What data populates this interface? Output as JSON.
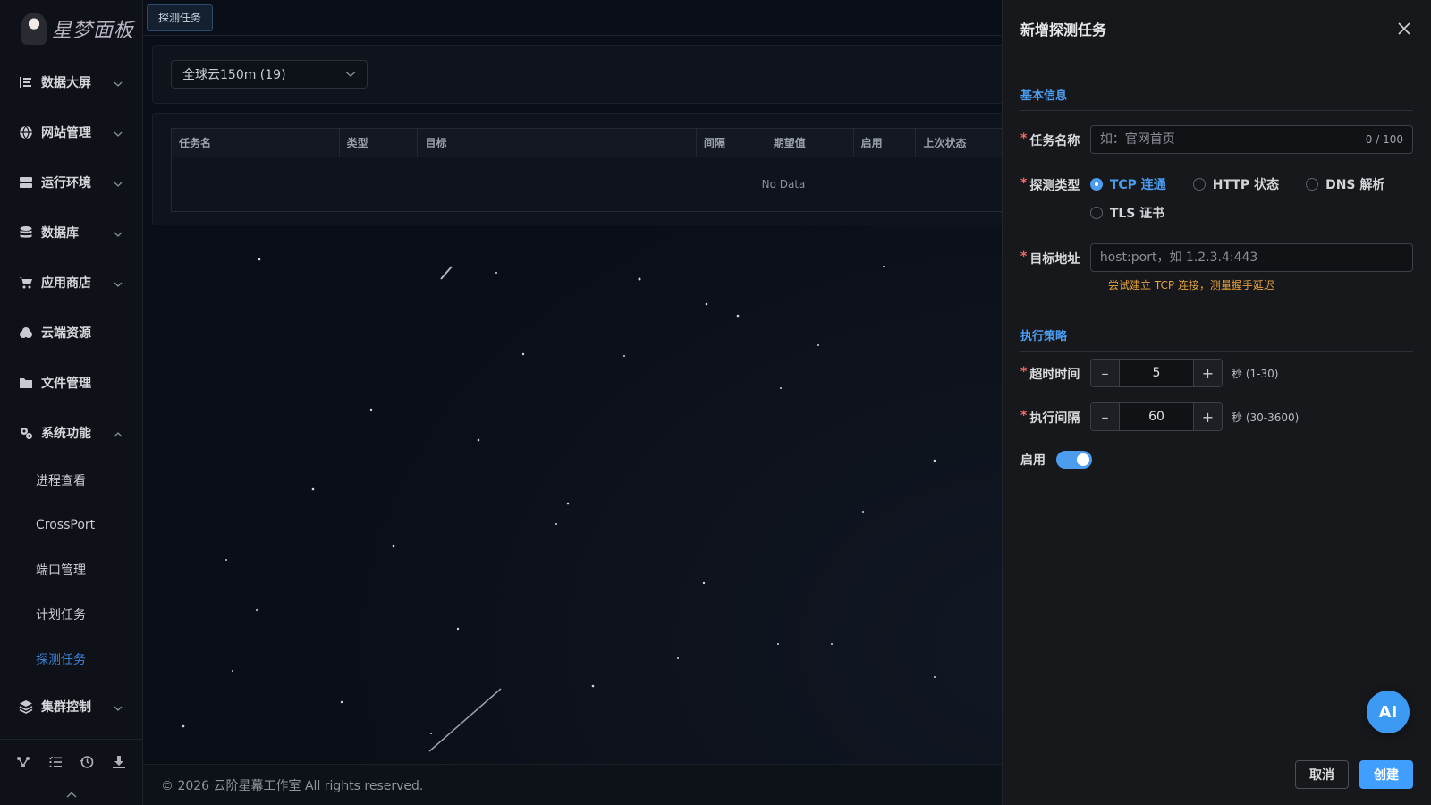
{
  "app": {
    "logo_text": "星梦面板"
  },
  "sidebar": {
    "menu": [
      {
        "label": "数据大屏",
        "icon": "chart-list-icon",
        "expandable": true
      },
      {
        "label": "网站管理",
        "icon": "globe-icon",
        "expandable": true
      },
      {
        "label": "运行环境",
        "icon": "server-icon",
        "expandable": true
      },
      {
        "label": "数据库",
        "icon": "database-icon",
        "expandable": true
      },
      {
        "label": "应用商店",
        "icon": "cart-icon",
        "expandable": true
      },
      {
        "label": "云端资源",
        "icon": "cloud-icon",
        "expandable": false
      },
      {
        "label": "文件管理",
        "icon": "folder-icon",
        "expandable": false
      },
      {
        "label": "系统功能",
        "icon": "gears-icon",
        "expandable": true,
        "expanded": true
      }
    ],
    "submenu": [
      {
        "label": "进程查看"
      },
      {
        "label": "CrossPort"
      },
      {
        "label": "端口管理"
      },
      {
        "label": "计划任务"
      },
      {
        "label": "探测任务",
        "active": true
      }
    ],
    "last_menu": {
      "label": "集群控制",
      "icon": "layers-icon"
    },
    "footer_icons": [
      "branch-icon",
      "task-list-icon",
      "history-icon",
      "download-icon"
    ]
  },
  "main": {
    "tab": "探测任务",
    "group_select": "全球云150m (19)",
    "table": {
      "columns": [
        "任务名",
        "类型",
        "目标",
        "间隔",
        "期望值",
        "启用",
        "上次状态"
      ],
      "empty_text": "No Data"
    },
    "footer": "© 2026 云阶星幕工作室 All rights reserved."
  },
  "drawer": {
    "title": "新增探测任务",
    "section_basic": "基本信息",
    "name_label": "任务名称",
    "name_placeholder": "如：官网首页",
    "name_counter": "0 / 100",
    "type_label": "探测类型",
    "type_options": [
      {
        "label": "TCP 连通",
        "checked": true
      },
      {
        "label": "HTTP 状态",
        "checked": false
      },
      {
        "label": "DNS 解析",
        "checked": false
      },
      {
        "label": "TLS 证书",
        "checked": false
      }
    ],
    "target_label": "目标地址",
    "target_placeholder": "host:port，如 1.2.3.4:443",
    "target_hint": "尝试建立 TCP 连接，测量握手延迟",
    "section_policy": "执行策略",
    "timeout_label": "超时时间",
    "timeout_value": "5",
    "timeout_unit": "秒 (1-30)",
    "interval_label": "执行间隔",
    "interval_value": "60",
    "interval_unit": "秒 (30-3600)",
    "enable_label": "启用",
    "enable_on": true,
    "cancel": "取消",
    "create": "创建",
    "ai_button": "AI"
  },
  "colors": {
    "accent": "#409eff",
    "warning": "#e6a23c",
    "required": "#f56c6c",
    "active_menu": "#3b82d6"
  }
}
